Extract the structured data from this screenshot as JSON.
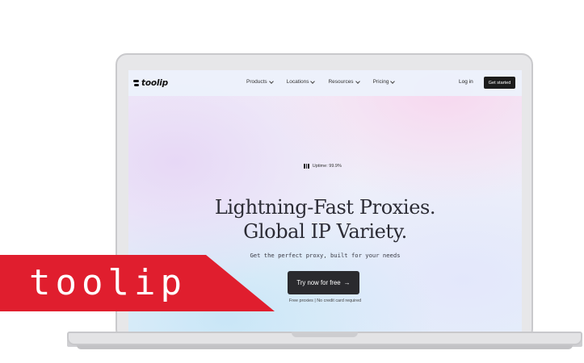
{
  "nav": {
    "brand": "toolip",
    "menu": [
      "Products",
      "Locations",
      "Resources",
      "Pricing"
    ],
    "login": "Log in",
    "cta": "Get started"
  },
  "hero": {
    "uptime": "Uptime: 99.9%",
    "headline_line1": "Lightning-Fast Proxies.",
    "headline_line2": "Global IP Variety.",
    "subtitle": "Get the perfect proxy, built for your needs",
    "button": "Try now for free",
    "button_icon": "arrow-right-icon",
    "note": "Free proxies | No credit card required"
  },
  "banner": {
    "text": "toolip",
    "color": "#e01e2e"
  }
}
